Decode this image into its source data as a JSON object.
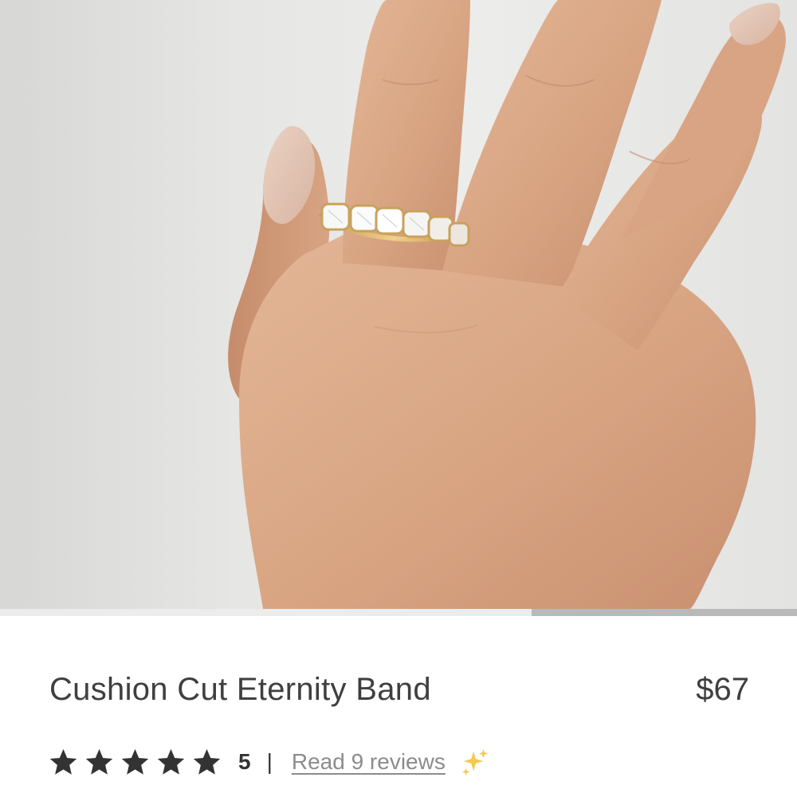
{
  "product": {
    "title": "Cushion Cut Eternity Band",
    "price": "$67"
  },
  "gallery": {
    "image_description_icon": "hand-with-ring-photo",
    "progress_fraction": 0.667
  },
  "rating": {
    "stars": 5,
    "value": "5",
    "separator": "|",
    "reviews_link": "Read 9 reviews",
    "sparkle_icon": "sparkles-icon"
  },
  "colors": {
    "text": "#3f3f3f",
    "star": "#333333",
    "link": "#8c8c8c",
    "sparkle": "#f3c94f"
  }
}
